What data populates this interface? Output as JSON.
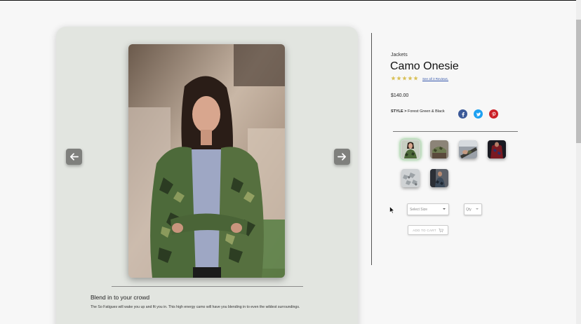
{
  "product": {
    "category": "Jackets",
    "title": "Camo Onesie",
    "rating": 5,
    "reviews_link": "See all 3 Reviews.",
    "price": "$140.00",
    "style_label": "STYLE >",
    "style_value": "Forest Green & Black"
  },
  "gallery": {
    "blurb_title": "Blend in to your crowd",
    "blurb_text": "The So Fatigues will wake you up and fit you in. This high energy camo will have you blending in to even the wildest surroundings."
  },
  "thumbnails": [
    {
      "name": "camo-woman-thumb",
      "selected": true
    },
    {
      "name": "camo-cap-thumb",
      "selected": false
    },
    {
      "name": "camo-hands-thumb",
      "selected": false
    },
    {
      "name": "red-camo-thumb",
      "selected": false
    },
    {
      "name": "grey-camo-thumb",
      "selected": false
    },
    {
      "name": "camo-man-thumb",
      "selected": false
    }
  ],
  "purchase": {
    "size_placeholder": "Select Size",
    "qty_placeholder": "Qty",
    "add_to_cart": "ADD TO CART"
  },
  "social": [
    "facebook-icon",
    "twitter-icon",
    "pinterest-icon"
  ],
  "colors": {
    "facebook": "#3b5998",
    "twitter": "#1da1f2",
    "pinterest": "#cb2027",
    "star": "#d9c15a"
  }
}
